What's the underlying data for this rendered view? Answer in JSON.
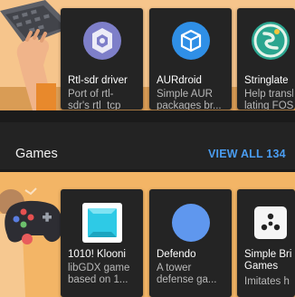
{
  "top_row": {
    "apps": [
      {
        "name": "Rtl-sdr driver",
        "description": "Port of rtl-\nsdr's rtl_tcp",
        "icon": "rtl-sdr-icon"
      },
      {
        "name": "AURdroid",
        "description": "Simple AUR\npackages br...",
        "icon": "package-cube-icon"
      },
      {
        "name": "Stringlate",
        "description": "Help transl\nlating FOSS",
        "icon": "stringlate-icon"
      }
    ]
  },
  "games_section": {
    "title": "Games",
    "view_all_label": "VIEW ALL 134",
    "accent_color": "#4a9df2",
    "apps": [
      {
        "name": "1010! Klooni",
        "description": "libGDX game\nbased on 1...",
        "icon": "cyan-block-icon"
      },
      {
        "name": "Defendo",
        "description": "A tower\ndefense ga...",
        "icon": "blue-circle-icon"
      },
      {
        "name": "Simple Bri\nGames",
        "description": "Imitates h",
        "icon": "dice-icon"
      }
    ]
  }
}
